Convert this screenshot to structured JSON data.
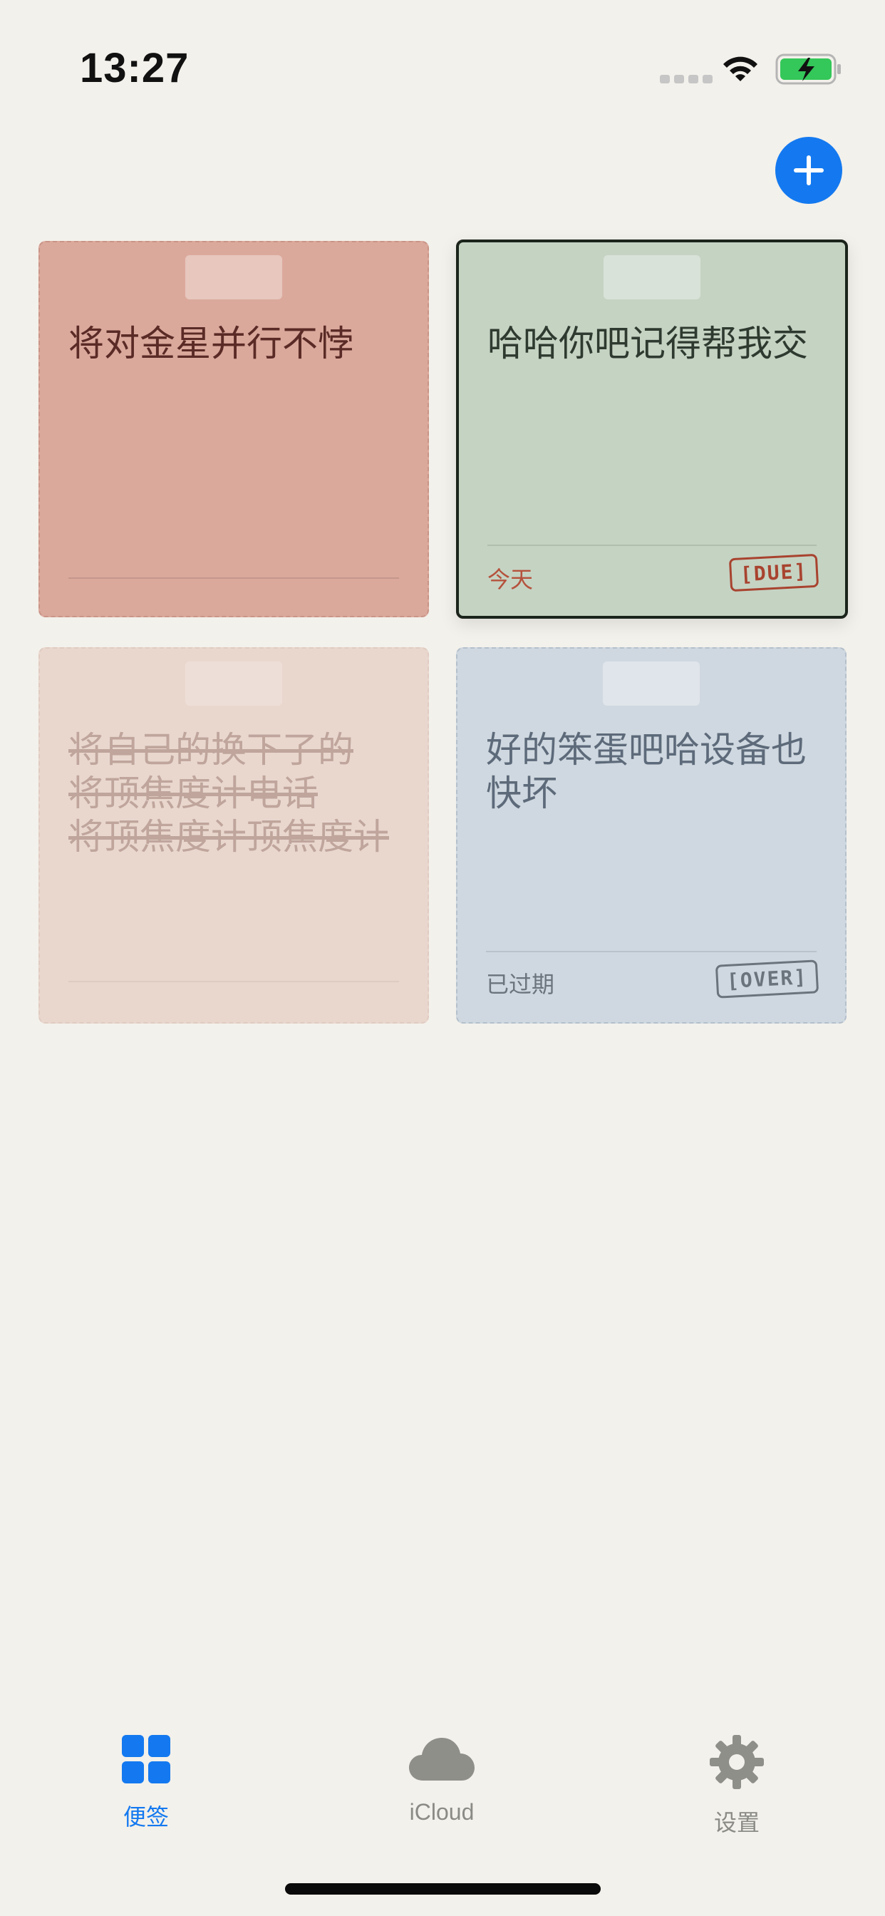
{
  "status_bar": {
    "time": "13:27"
  },
  "header": {
    "add_button_icon": "plus-icon",
    "accent_color": "#1479f0"
  },
  "notes": [
    {
      "text": "将对金星并行不悖",
      "date_label": "",
      "stamp": "",
      "color": "#dba99c"
    },
    {
      "text": "哈哈你吧记得帮我交",
      "date_label": "今天",
      "stamp": "[DUE]",
      "color": "#c5d3c3"
    },
    {
      "text": "将自己的换下了的\n将顶焦度计电话\n将顶焦度计顶焦度计",
      "date_label": "",
      "stamp": "",
      "color": "#e9d7ce",
      "completed": true
    },
    {
      "text": "好的笨蛋吧哈设备也\n快坏",
      "date_label": "已过期",
      "stamp": "[OVER]",
      "color": "#cfd8e0"
    }
  ],
  "tab_bar": {
    "items": [
      {
        "label": "便签",
        "icon": "grid-icon",
        "selected": true
      },
      {
        "label": "iCloud",
        "icon": "cloud-icon",
        "selected": false
      },
      {
        "label": "设置",
        "icon": "gear-icon",
        "selected": false
      }
    ]
  }
}
